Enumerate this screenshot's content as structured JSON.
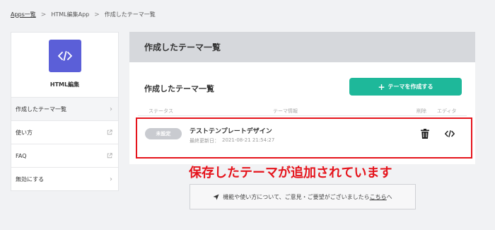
{
  "breadcrumb": {
    "items": [
      "Apps一覧",
      "HTML編集App",
      "作成したテーマ一覧"
    ],
    "separator": ">"
  },
  "sidebar": {
    "app_name": "HTML編集",
    "app_icon": "code-icon",
    "items": [
      {
        "label": "作成したテーマ一覧",
        "icon": "chevron-right-icon"
      },
      {
        "label": "使い方",
        "icon": "external-link-icon"
      },
      {
        "label": "FAQ",
        "icon": "external-link-icon"
      },
      {
        "label": "無効にする",
        "icon": "chevron-right-icon"
      }
    ]
  },
  "header": {
    "title": "作成したテーマ一覧"
  },
  "card": {
    "title": "作成したテーマ一覧",
    "create_button": "テーマを作成する",
    "columns": {
      "status": "ステータス",
      "info": "テーマ情報",
      "delete": "削除",
      "editor": "エディタ"
    }
  },
  "theme": {
    "status": "未設定",
    "name": "テストテンプレートデザイン",
    "updated_label": "最終更新日：",
    "updated_at": "2021-08-21 21:54:27"
  },
  "annotation": {
    "text": "保存したテーマが追加されています"
  },
  "feedback": {
    "text": "機能や使い方について、ご意見・ご要望がございましたら",
    "link": "こちら",
    "suffix": "へ"
  },
  "colors": {
    "accent": "#1eb89a",
    "logo": "#5b5fd8",
    "highlight": "#e5141c"
  }
}
